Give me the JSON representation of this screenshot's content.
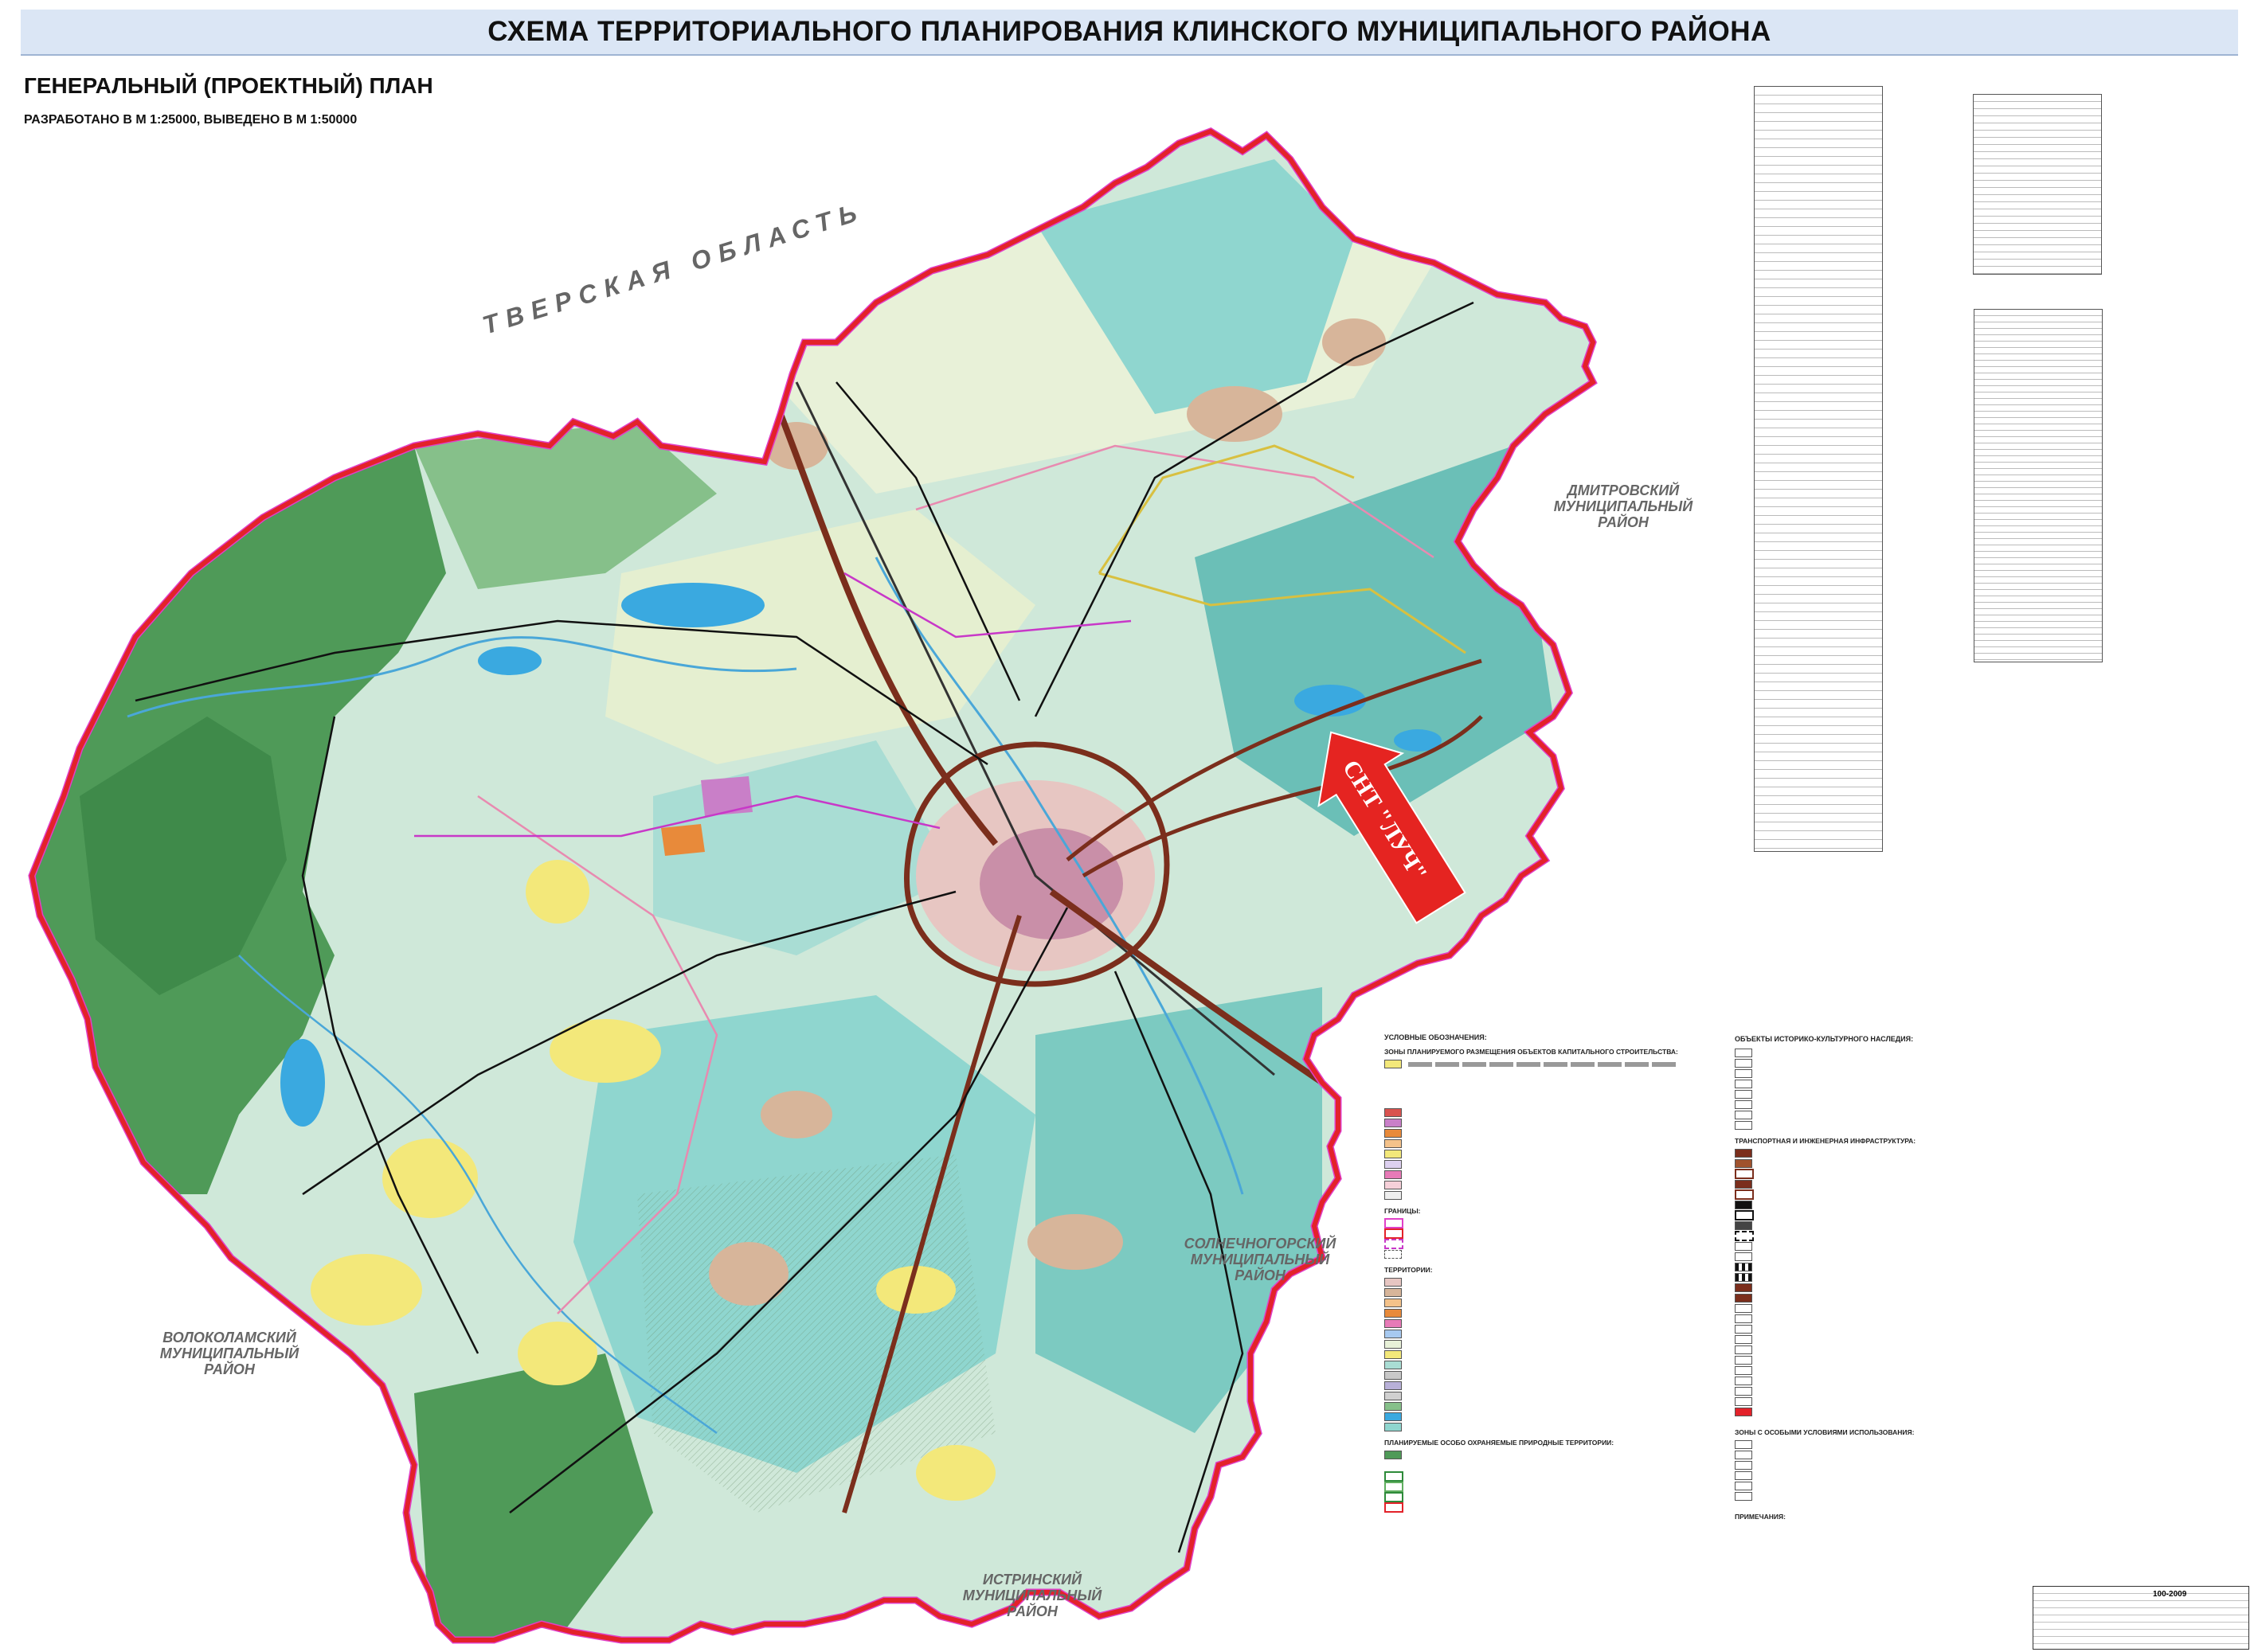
{
  "header": {
    "title": "СХЕМА ТЕРРИТОРИАЛЬНОГО ПЛАНИРОВАНИЯ КЛИНСКОГО МУНИЦИПАЛЬНОГО РАЙОНА",
    "subtitle": "ГЕНЕРАЛЬНЫЙ (ПРОЕКТНЫЙ) ПЛАН",
    "scale_note": "РАЗРАБОТАНО В М 1:25000, ВЫВЕДЕНО В М 1:50000"
  },
  "map": {
    "neighbors": {
      "tver": "ТВЕРСКАЯ ОБЛАСТЬ",
      "dmitrov": [
        "ДМИТРОВСКИЙ",
        "МУНИЦИПАЛЬНЫЙ",
        "РАЙОН"
      ],
      "solnechnogorsk": [
        "СОЛНЕЧНОГОРСКИЙ",
        "МУНИЦИПАЛЬНЫЙ",
        "РАЙОН"
      ],
      "volokolamsk": [
        "ВОЛОКОЛАМСКИЙ",
        "МУНИЦИПАЛЬНЫЙ",
        "РАЙОН"
      ],
      "istra": [
        "ИСТРИНСКИЙ",
        "МУНИЦИПАЛЬНЫЙ",
        "РАЙОН"
      ]
    },
    "marker_label": "СНТ \"ЛУЧ\"",
    "colors": {
      "boundary": "#e3222a",
      "boundary_outer": "#e040c8",
      "forest": "#4f9a58",
      "forest_light": "#86c08a",
      "cyan": "#8fd6cf",
      "teal": "#6bbfb7",
      "pale": "#e8f1d8",
      "settlement": "#d7b59a",
      "city": "#c98fa8",
      "water": "#3aa9e0",
      "marker": "#e52421"
    }
  },
  "legend": {
    "title": "УСЛОВНЫЕ ОБОЗНАЧЕНИЯ:",
    "section_zones": "ЗОНЫ ПЛАНИРУЕМОГО РАЗМЕЩЕНИЯ ОБЪЕКТОВ КАПИТАЛЬНОГО СТРОИТЕЛЬСТВА:",
    "section_borders": "ГРАНИЦЫ:",
    "section_territories": "ТЕРРИТОРИИ:",
    "section_protected": "ПЛАНИРУЕМЫЕ ОСОБО ОХРАНЯЕМЫЕ ПРИРОДНЫЕ ТЕРРИТОРИИ:",
    "heritage_title": "ОБЪЕКТЫ ИСТОРИКО-КУЛЬТУРНОГО НАСЛЕДИЯ:",
    "transport_title": "ТРАНСПОРТНАЯ И ИНЖЕНЕРНАЯ ИНФРАСТРУКТУРА:",
    "special_zones_title": "ЗОНЫ С ОСОБЫМИ УСЛОВИЯМИ ИСПОЛЬЗОВАНИЯ:",
    "notes_title": "ПРИМЕЧАНИЯ:"
  },
  "stamp": {
    "code": "100-2009"
  }
}
